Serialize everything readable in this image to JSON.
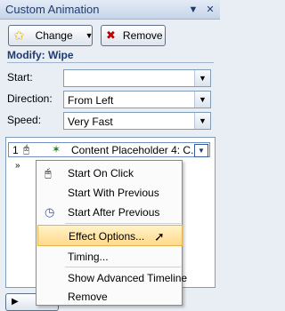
{
  "title": "Custom Animation",
  "toolbar": {
    "change_label": "Change",
    "remove_label": "Remove"
  },
  "section": {
    "title": "Modify: Wipe"
  },
  "fields": {
    "start_label": "Start:",
    "start_value": "",
    "direction_label": "Direction:",
    "direction_value": "From Left",
    "speed_label": "Speed:",
    "speed_value": "Very Fast"
  },
  "list": {
    "row1_number": "1",
    "row1_name": "Content Placeholder 4: C..."
  },
  "menu": {
    "items": [
      {
        "label": "Start On Click"
      },
      {
        "label": "Start With Previous"
      },
      {
        "label": "Start After Previous"
      },
      {
        "label": "Effect Options..."
      },
      {
        "label": "Timing..."
      },
      {
        "label": "Show Advanced Timeline"
      },
      {
        "label": "Remove"
      }
    ]
  },
  "colors": {
    "accent": "#1f3b6e",
    "highlight": "#ffd98a"
  }
}
